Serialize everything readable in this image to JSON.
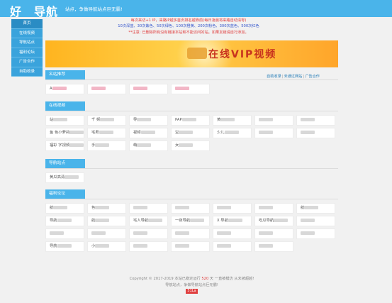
{
  "header": {
    "logo": "好　导航",
    "slogan": "站点，争做导航站点巨无霸!"
  },
  "sidebar": {
    "items": [
      {
        "label": "首页"
      },
      {
        "label": "在线视频"
      },
      {
        "label": "导航站点"
      },
      {
        "label": "福利论坛"
      },
      {
        "label": "广告合作"
      },
      {
        "label": "自助收录"
      }
    ]
  },
  "notice": {
    "line1": "每次来访+1 IP，来路IP越多首页排名越靠前(每日凌晨将来路自动清零)",
    "line2": "10次深蓝、30次紫色、50次绿色、100次橙黄、200次粉色、300次蓝色、500次红色",
    "line3": "**注意: 已删除所有没有链接本站和不能访问的站。如果友链请自行添加。"
  },
  "banner": {
    "text": "在线VIP视频"
  },
  "sections": {
    "recommend": "名站推荐",
    "video": "在线视频",
    "nav": "导航站点",
    "forum": "福利论坛"
  },
  "quick_links": {
    "self_submit": "自助收录",
    "unapproved": "未通过网站",
    "ad_coop": "广告合作"
  },
  "recommend_items": [
    {
      "label": "A",
      "red": true
    },
    {
      "label": "",
      "red": true
    },
    {
      "label": "",
      "red": true
    },
    {
      "label": "",
      "red": true
    }
  ],
  "video_items": [
    {
      "label": "站"
    },
    {
      "label": "千 频"
    },
    {
      "label": "导"
    },
    {
      "label": "PAP"
    },
    {
      "label": "黄"
    },
    {
      "label": ""
    },
    {
      "label": ""
    },
    {
      "label": "鱼 色小萝莉"
    },
    {
      "label": "宅男"
    },
    {
      "label": "视频"
    },
    {
      "label": "宝"
    },
    {
      "label": "少儿"
    },
    {
      "label": ""
    },
    {
      "label": ""
    },
    {
      "label": "福彩 字视频"
    },
    {
      "label": "手"
    },
    {
      "label": "萌"
    },
    {
      "label": "女"
    }
  ],
  "nav_items": [
    {
      "label": "黄瓜高清"
    }
  ],
  "forum_items": [
    {
      "label": "航"
    },
    {
      "label": "色"
    },
    {
      "label": ""
    },
    {
      "label": ""
    },
    {
      "label": ""
    },
    {
      "label": ""
    },
    {
      "label": "航"
    },
    {
      "label": "导航"
    },
    {
      "label": "航"
    },
    {
      "label": "宅人导航"
    },
    {
      "label": "一夜导航"
    },
    {
      "label": "X 导航"
    },
    {
      "label": "吃瓜导航"
    },
    {
      "label": ""
    },
    {
      "label": ""
    },
    {
      "label": ""
    },
    {
      "label": ""
    },
    {
      "label": ""
    },
    {
      "label": ""
    },
    {
      "label": ""
    },
    {
      "label": ""
    },
    {
      "label": "导航"
    },
    {
      "label": "小"
    },
    {
      "label": ""
    },
    {
      "label": ""
    },
    {
      "label": ""
    },
    {
      "label": ""
    }
  ],
  "footer": {
    "line1_a": "Copyright © 2017-2019 本站已稳定运行",
    "line1_b": "520",
    "line1_c": "天 一直被模仿 从未被超越!",
    "line2": "导航站点，争做导航站点巨无霸!",
    "badge": "51La"
  }
}
